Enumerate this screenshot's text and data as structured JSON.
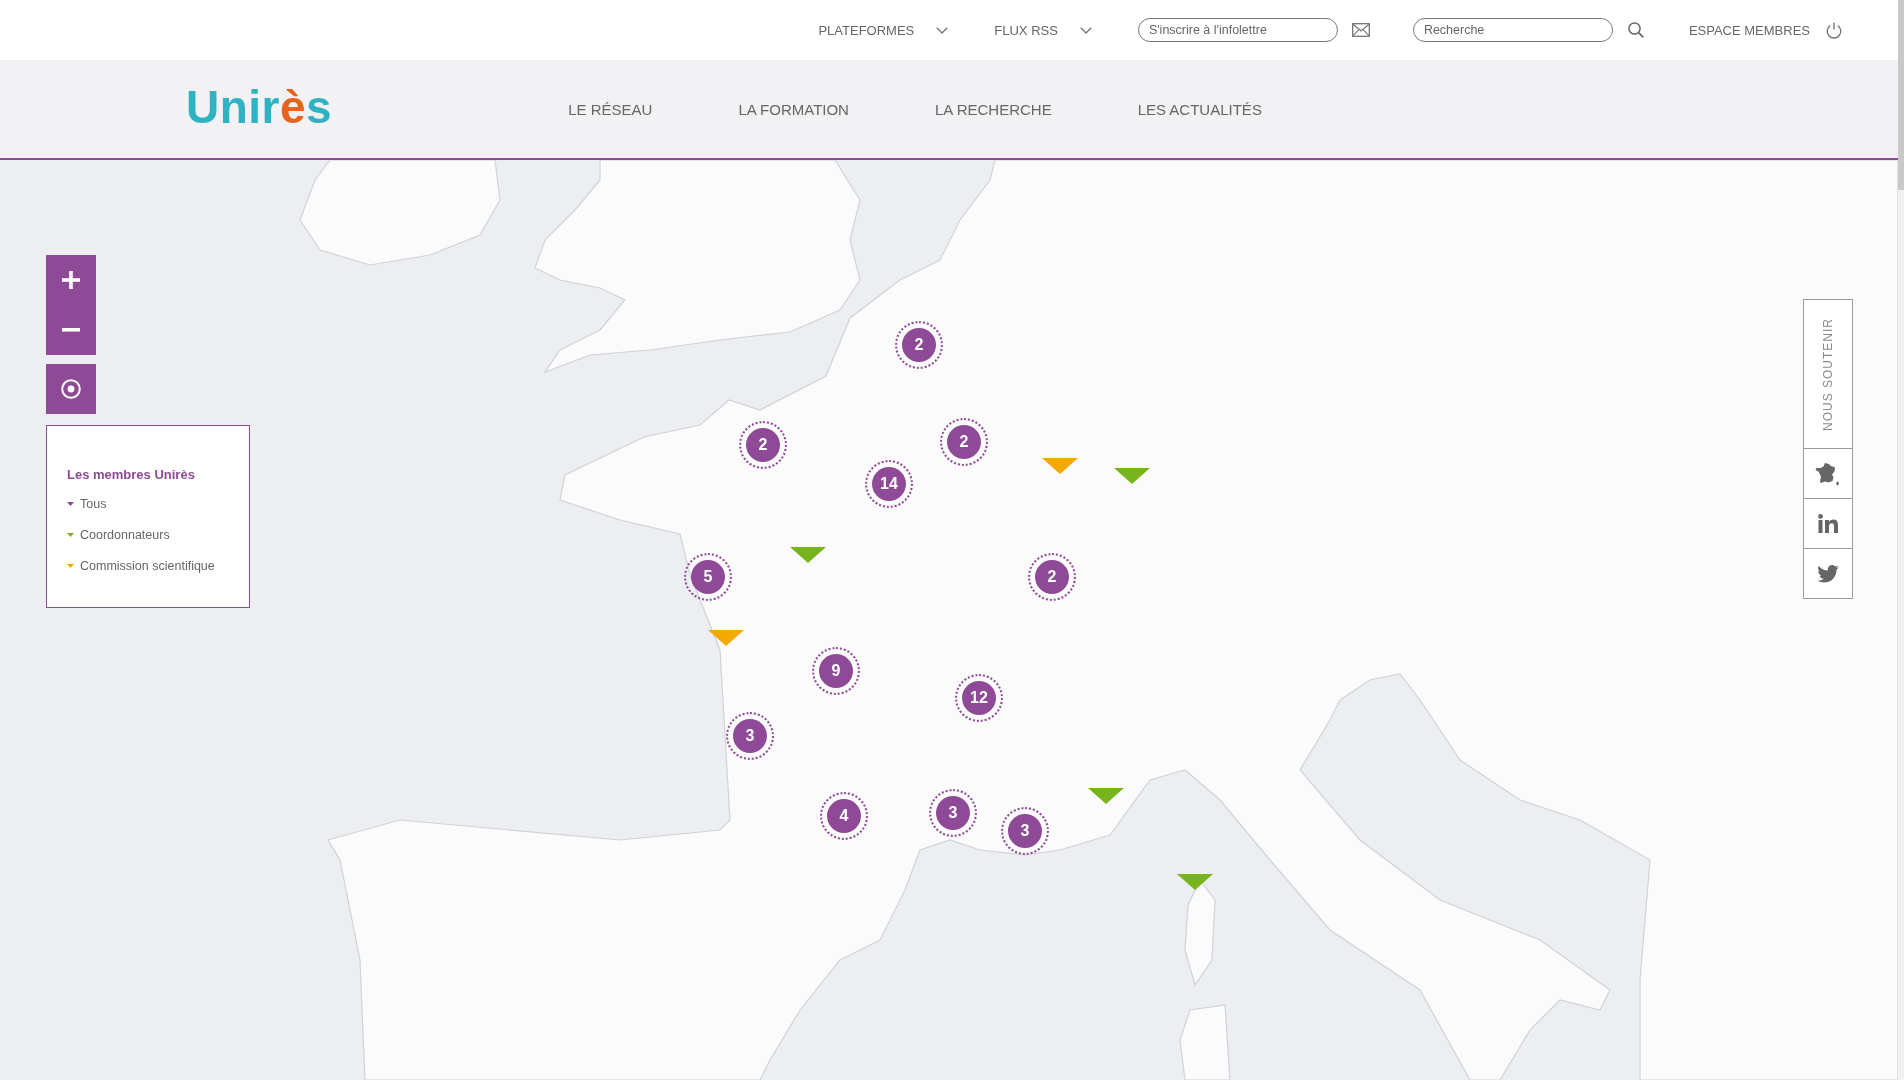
{
  "top_bar": {
    "menus": [
      {
        "label": "PLATEFORMES"
      },
      {
        "label": "FLUX RSS"
      }
    ],
    "newsletter_field": {
      "placeholder": "S'inscrire à l'infolettre"
    },
    "search_field": {
      "placeholder": "Recherche"
    },
    "members_link": {
      "label": "ESPACE MEMBRES"
    }
  },
  "header": {
    "logo": {
      "parts": [
        {
          "text": "Unir",
          "color": "#2fb3c2"
        },
        {
          "text": "è",
          "color": "#e8641e"
        },
        {
          "text": "s",
          "color": "#2fb3c2"
        }
      ]
    },
    "nav": [
      {
        "label": "LE RÉSEAU"
      },
      {
        "label": "LA FORMATION"
      },
      {
        "label": "LA RECHERCHE"
      },
      {
        "label": "LES ACTUALITÉS"
      }
    ]
  },
  "legend": {
    "title": "Les membres Unirès",
    "items": [
      {
        "label": "Tous",
        "color": "#8e4a96"
      },
      {
        "label": "Coordonnateurs",
        "color": "#78b41e"
      },
      {
        "label": "Commission scientifique",
        "color": "#f5a800"
      }
    ]
  },
  "map": {
    "markers": [
      {
        "kind": "cluster",
        "count": "2"
      },
      {
        "kind": "cluster",
        "count": "2"
      },
      {
        "kind": "cluster",
        "count": "2"
      },
      {
        "kind": "pin",
        "color": "#f5a800"
      },
      {
        "kind": "pin",
        "color": "#78b41e"
      },
      {
        "kind": "cluster",
        "count": "14"
      },
      {
        "kind": "pin",
        "color": "#78b41e"
      },
      {
        "kind": "cluster",
        "count": "5"
      },
      {
        "kind": "cluster",
        "count": "2"
      },
      {
        "kind": "pin",
        "color": "#f5a800"
      },
      {
        "kind": "cluster",
        "count": "9"
      },
      {
        "kind": "cluster",
        "count": "12"
      },
      {
        "kind": "cluster",
        "count": "3"
      },
      {
        "kind": "pin",
        "color": "#78b41e"
      },
      {
        "kind": "cluster",
        "count": "3"
      },
      {
        "kind": "cluster",
        "count": "4"
      },
      {
        "kind": "cluster",
        "count": "3"
      },
      {
        "kind": "pin",
        "color": "#78b41e"
      }
    ]
  },
  "side_bar": {
    "support_label": "NOUS SOUTENIR"
  }
}
